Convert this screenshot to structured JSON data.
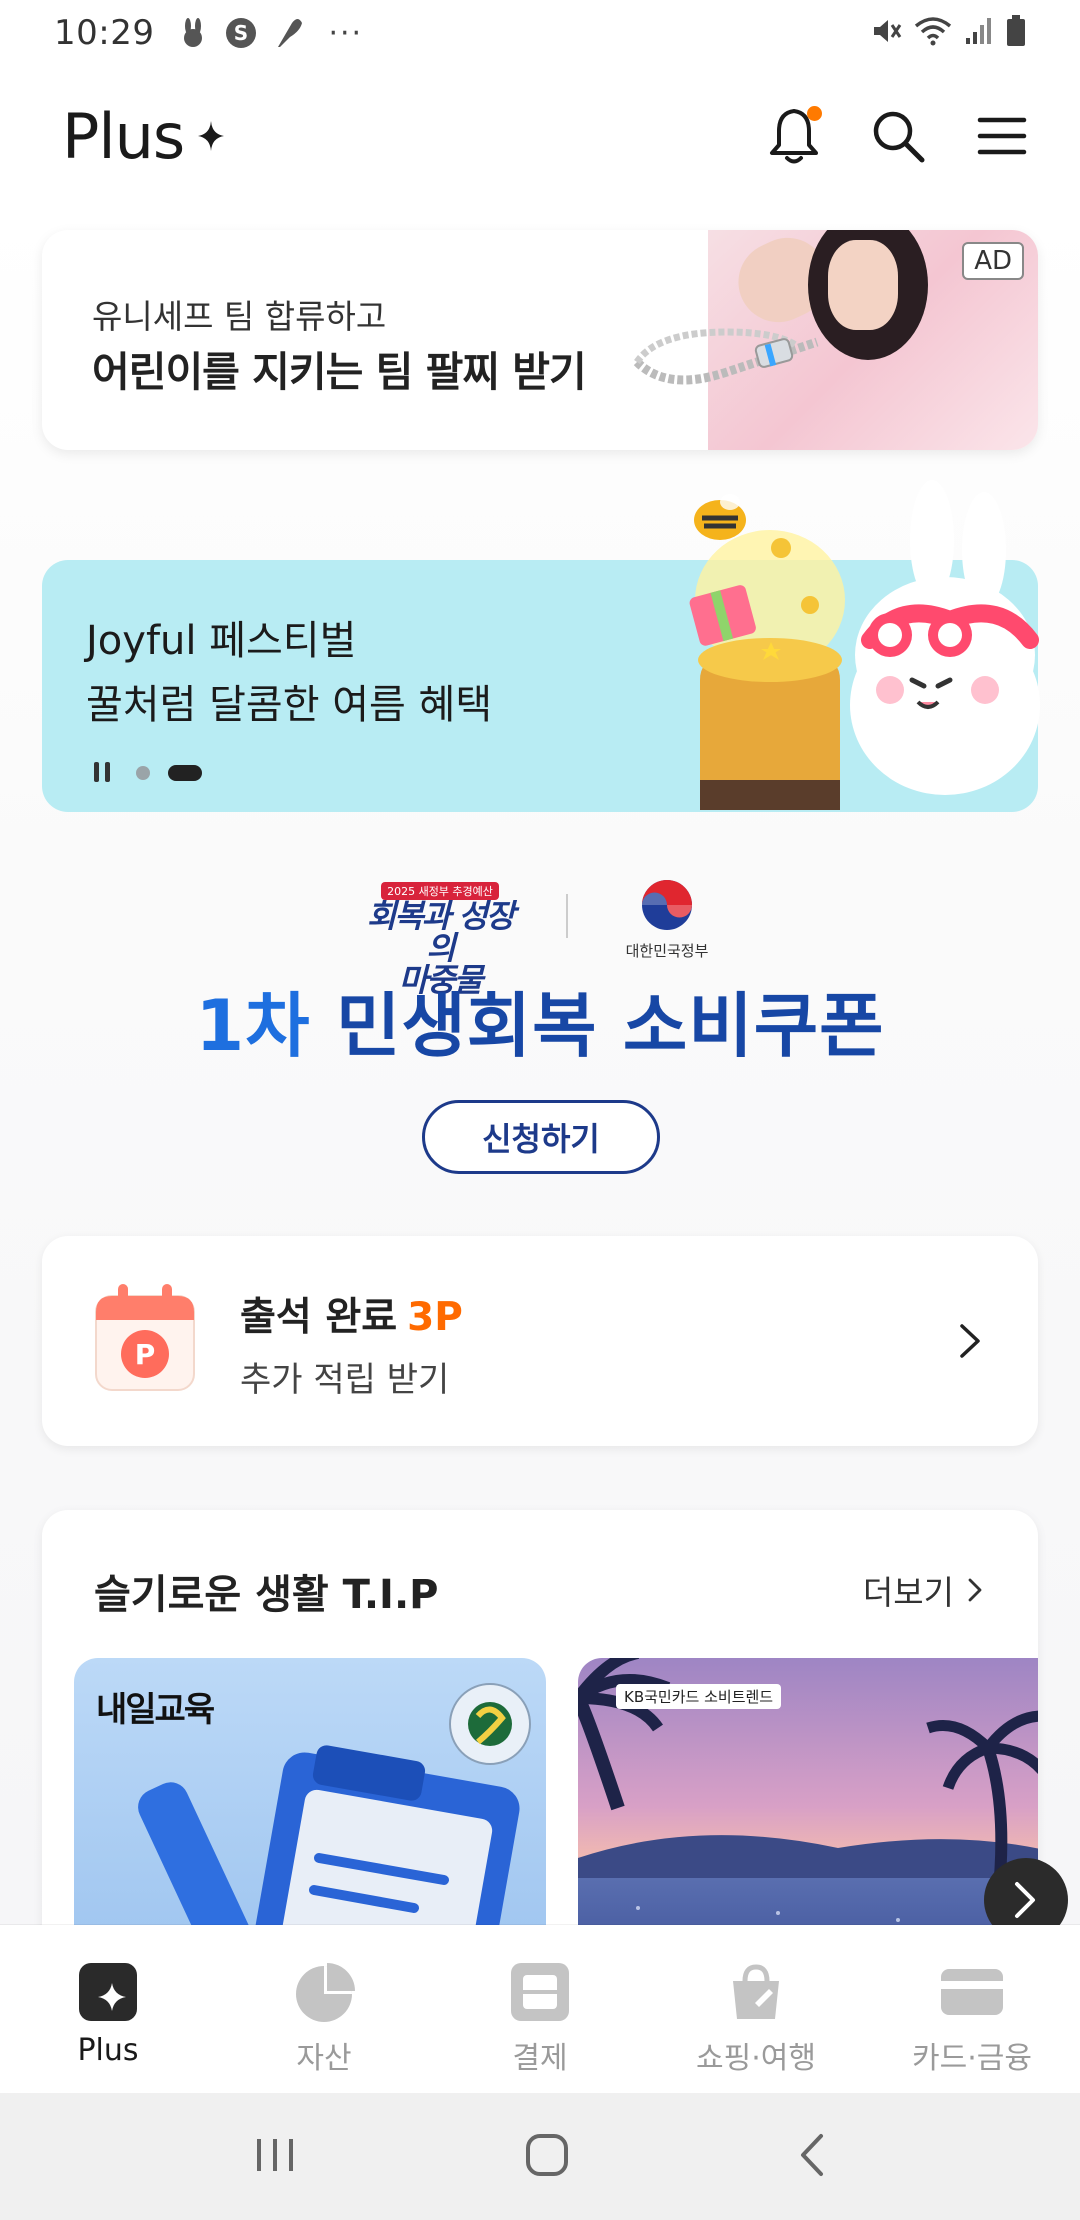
{
  "status_bar": {
    "time": "10:29",
    "dots": "···"
  },
  "header": {
    "logo": "Plus"
  },
  "ad_banner": {
    "subtitle": "유니세프 팀 합류하고",
    "title": "어린이를 지키는 팀 팔찌 받기",
    "badge": "AD"
  },
  "festival_banner": {
    "line1": "Joyful 페스티벌",
    "line2": "꿀처럼 달콤한 여름 혜택",
    "slide_count": 2,
    "active_slide": 2
  },
  "coupon": {
    "year_badge": "2025 새정부 추경예산",
    "slogan_line1": "회복과 성장의",
    "slogan_line2": "마중물",
    "gov_name": "대한민국정부",
    "title_num": "1차",
    "title_rest": " 민생회복 소비쿠폰",
    "button_label": "신청하기"
  },
  "attendance": {
    "title": "출석 완료",
    "points": "3P",
    "subtitle": "추가 적립 받기",
    "icon_letter": "P"
  },
  "tips": {
    "heading": "슬기로운 생활 T.I.P",
    "more_label": "더보기",
    "cards": [
      {
        "label": "내일교육"
      },
      {
        "label": "KB국민카드 소비트렌드"
      }
    ]
  },
  "bottom_nav": {
    "items": [
      {
        "label": "Plus",
        "active": true
      },
      {
        "label": "자산",
        "active": false
      },
      {
        "label": "결제",
        "active": false
      },
      {
        "label": "쇼핑·여행",
        "active": false
      },
      {
        "label": "카드·금융",
        "active": false
      }
    ]
  },
  "colors": {
    "accent_orange": "#ff6a00",
    "coupon_blue": "#1747a5",
    "festival_bg": "#b8ecf3"
  }
}
